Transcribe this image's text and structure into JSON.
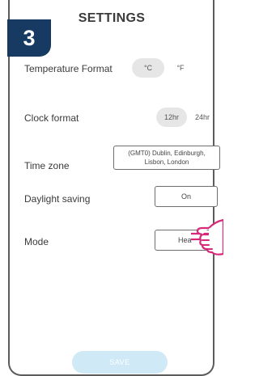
{
  "step_number": "3",
  "title": "SETTINGS",
  "temperature": {
    "label": "Temperature Format",
    "options": [
      "°C",
      "°F"
    ],
    "selected": "°C"
  },
  "clock": {
    "label": "Clock format",
    "options": [
      "12hr",
      "24hr"
    ],
    "selected": "12hr"
  },
  "timezone": {
    "label": "Time zone",
    "value": "(GMT0) Dublin, Edinburgh, Lisbon, London"
  },
  "daylight": {
    "label": "Daylight saving",
    "value": "On"
  },
  "mode": {
    "label": "Mode",
    "value": "Hea"
  },
  "save_label": "SAVE",
  "colors": {
    "badge": "#173a63",
    "hand": "#d6297a",
    "save": "#cfe9f7"
  },
  "icons": {
    "pointer": "pointing-hand-icon"
  }
}
